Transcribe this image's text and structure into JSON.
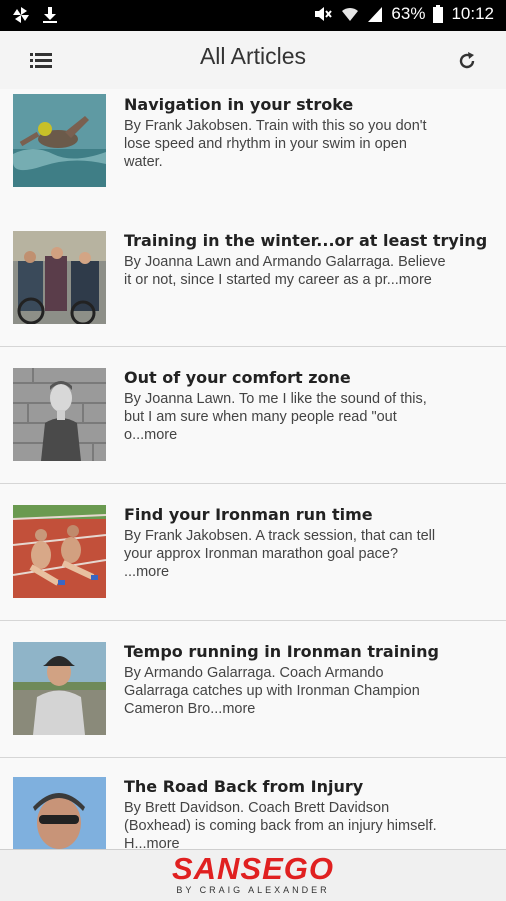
{
  "status_bar": {
    "battery": "63%",
    "time": "10:12",
    "left_icons": [
      "pinwheel-icon",
      "download-icon"
    ],
    "right_icons": [
      "mute-icon",
      "wifi-icon",
      "signal-icon",
      "battery-icon"
    ]
  },
  "header": {
    "title": "All Articles",
    "menu_icon": "list-icon",
    "refresh_icon": "refresh-icon"
  },
  "articles": [
    {
      "title": "Navigation in your stroke",
      "line1": "By Frank Jakobsen. Train with this so you don't",
      "line2": "lose speed and rhythm in your swim in open",
      "line3": "water."
    },
    {
      "title": "Training in the winter...or at least trying",
      "line1": "By Joanna Lawn and Armando Galarraga. Believe",
      "line2": "it or not, since I started my career as a pr...more",
      "line3": ""
    },
    {
      "title": "Out of your comfort zone",
      "line1": "By Joanna Lawn. To me I like the sound of this,",
      "line2": "but I am sure when many people read \"out",
      "line3": "o...more"
    },
    {
      "title": "Find your Ironman run time",
      "line1": "By Frank Jakobsen. A track session, that can tell",
      "line2": "your approx Ironman marathon goal pace?",
      "line3": "...more"
    },
    {
      "title": "Tempo running in Ironman training",
      "line1": "By Armando Galarraga. Coach Armando",
      "line2": "Galarraga catches up with Ironman Champion",
      "line3": "Cameron Bro...more"
    },
    {
      "title": "The Road Back from Injury",
      "line1": "By Brett Davidson. Coach Brett Davidson",
      "line2": "(Boxhead) is coming back from an injury himself.",
      "line3": "H...more"
    }
  ],
  "footer": {
    "brand": "SANSEGO",
    "tagline": "BY CRAIG ALEXANDER"
  },
  "colors": {
    "brand_red": "#e02020",
    "status_bar": "#000000"
  }
}
